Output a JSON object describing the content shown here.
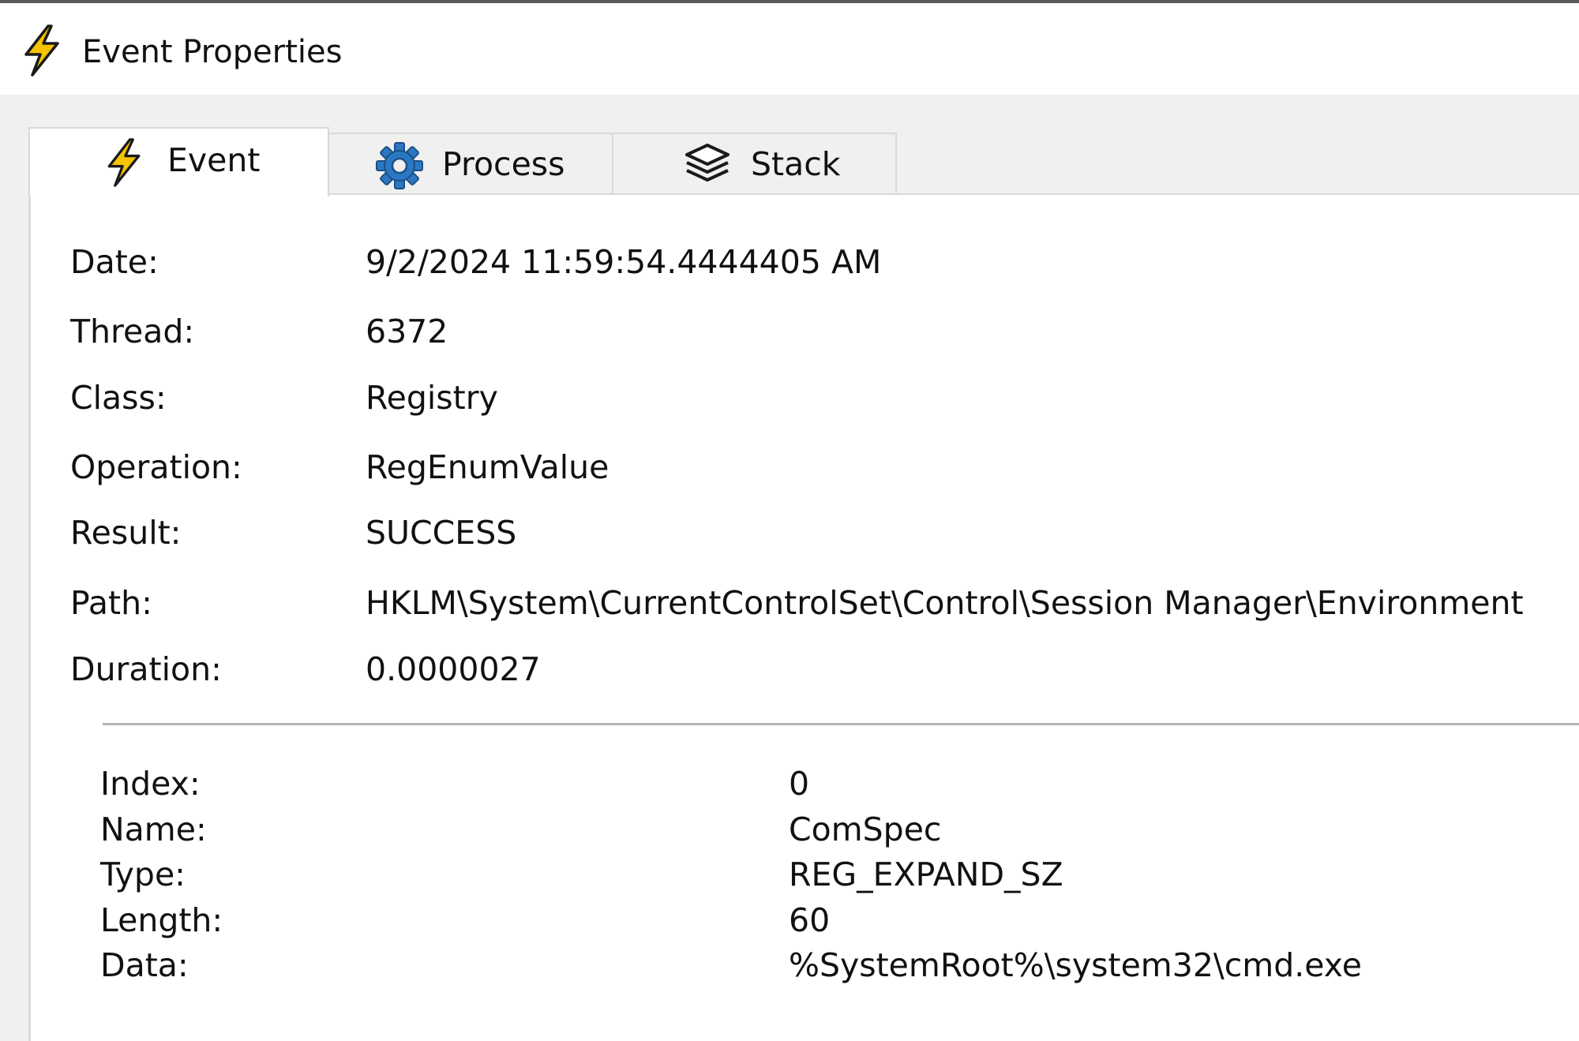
{
  "window": {
    "title": "Event Properties",
    "icon": "lightning-bolt-icon",
    "accent_color": "#f5c400"
  },
  "tabs": [
    {
      "label": "Event",
      "icon": "lightning-bolt-icon",
      "selected": true
    },
    {
      "label": "Process",
      "icon": "gear-icon",
      "selected": false
    },
    {
      "label": "Stack",
      "icon": "stack-layers-icon",
      "selected": false
    }
  ],
  "event": {
    "properties": [
      {
        "label": "Date:",
        "value": "9/2/2024 11:59:54.4444405 AM"
      },
      {
        "label": "Thread:",
        "value": "6372"
      },
      {
        "label": "Class:",
        "value": "Registry"
      },
      {
        "label": "Operation:",
        "value": "RegEnumValue"
      },
      {
        "label": "Result:",
        "value": "SUCCESS"
      },
      {
        "label": "Path:",
        "value": "HKLM\\System\\CurrentControlSet\\Control\\Session Manager\\Environment"
      },
      {
        "label": "Duration:",
        "value": "0.0000027"
      }
    ],
    "details": [
      {
        "label": "Index:",
        "value": "0"
      },
      {
        "label": "Name:",
        "value": "ComSpec"
      },
      {
        "label": "Type:",
        "value": "REG_EXPAND_SZ"
      },
      {
        "label": "Length:",
        "value": "60"
      },
      {
        "label": "Data:",
        "value": "%SystemRoot%\\system32\\cmd.exe"
      }
    ]
  }
}
